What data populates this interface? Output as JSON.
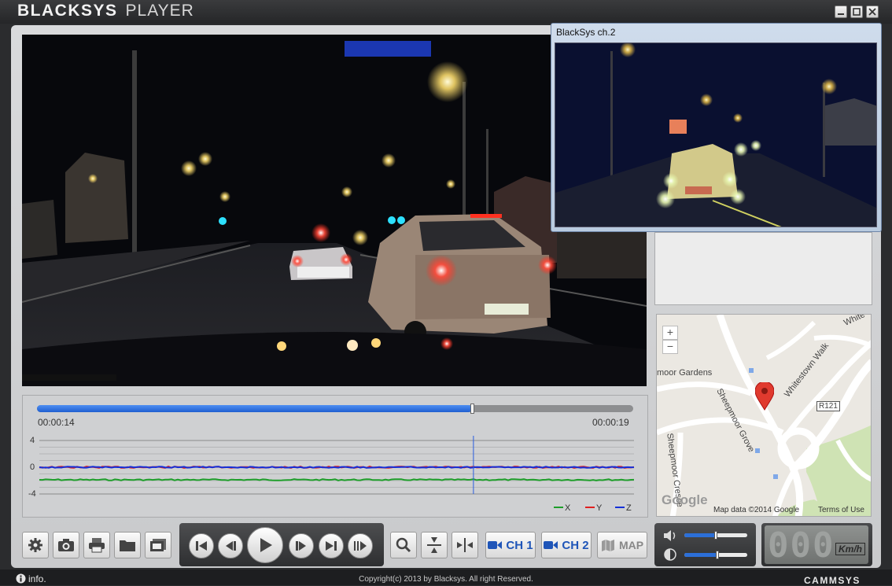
{
  "app": {
    "title_bold": "BLACKSYS",
    "title_light": "PLAYER"
  },
  "window_buttons": [
    "minimize-icon",
    "maximize-icon",
    "close-icon"
  ],
  "ch2_window": {
    "title": "BlackSys ch.2"
  },
  "timeline": {
    "current_time": "00:00:14",
    "end_time": "00:00:19",
    "progress": 0.73
  },
  "gsensor": {
    "y_ticks": [
      "4",
      "0",
      "-4"
    ],
    "legend": [
      {
        "label": "X",
        "color": "#1e9e2a"
      },
      {
        "label": "Y",
        "color": "#e02020"
      },
      {
        "label": "Z",
        "color": "#1530d8"
      }
    ]
  },
  "map": {
    "zoom_in": "+",
    "zoom_out": "−",
    "labels": [
      "moor Gardens",
      "Sheepmoor Grove",
      "Whitestown Walk",
      "R121",
      "Sheepmoor Cresce",
      "White"
    ],
    "provider": "Google",
    "attribution": "Map data ©2014 Google",
    "terms": "Terms of Use"
  },
  "toolbar": {
    "left_icons": [
      "gear-icon",
      "camera-icon",
      "printer-icon",
      "folder-icon",
      "film-icon"
    ],
    "transport_icons": [
      "skip-start-icon",
      "step-back-icon",
      "play-icon",
      "step-forward-icon",
      "skip-end-icon",
      "frame-advance-icon"
    ],
    "tool_icons": [
      "magnify-icon",
      "flip-vertical-icon",
      "flip-horizontal-icon"
    ],
    "ch1_label": "CH 1",
    "ch2_label": "CH 2",
    "map_label": "MAP"
  },
  "audio": {
    "volume": 0.5,
    "brightness": 0.52
  },
  "speed": {
    "value": "000",
    "unit": "Km/h"
  },
  "status": {
    "info": "info.",
    "copyright": "Copyright(c) 2013 by Blacksys. All right Reserved.",
    "brand": "CAMMSYS"
  },
  "colors": {
    "accent": "#2c6fd8",
    "seek_fill": "#1f5fd0",
    "frame": "#d0d1d3",
    "title_bar": "#2b2c2e"
  }
}
